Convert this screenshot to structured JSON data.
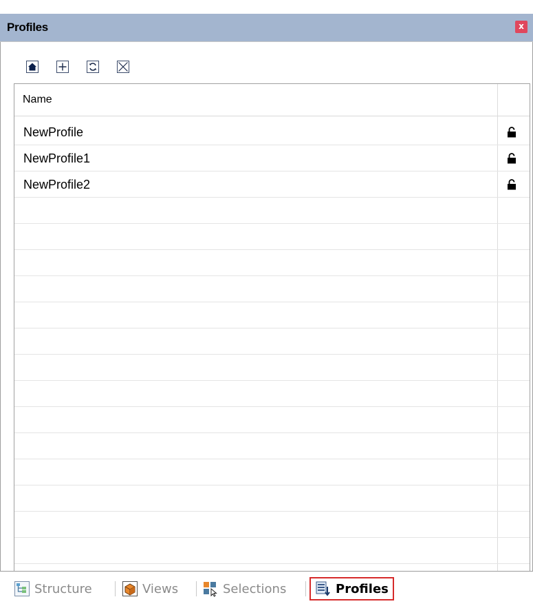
{
  "panel": {
    "title": "Profiles",
    "close_label": "x"
  },
  "toolbar": {
    "buttons": [
      {
        "icon": "home-icon"
      },
      {
        "icon": "plus-icon"
      },
      {
        "icon": "refresh-icon"
      },
      {
        "icon": "delete-icon"
      }
    ]
  },
  "grid": {
    "column_header": "Name",
    "rows": [
      {
        "name": "NewProfile",
        "icon": "unlocked-icon"
      },
      {
        "name": "NewProfile1",
        "icon": "unlocked-icon"
      },
      {
        "name": "NewProfile2",
        "icon": "unlocked-icon"
      }
    ]
  },
  "tabs": [
    {
      "label": "Structure",
      "icon": "structure-icon",
      "active": false
    },
    {
      "label": "Views",
      "icon": "views-icon",
      "active": false
    },
    {
      "label": "Selections",
      "icon": "selections-icon",
      "active": false
    },
    {
      "label": "Profiles",
      "icon": "profiles-icon",
      "active": true
    }
  ],
  "colors": {
    "titlebar": "#a3b5cf",
    "close_button": "#e0475d",
    "active_tab_border": "#d62a2a"
  }
}
